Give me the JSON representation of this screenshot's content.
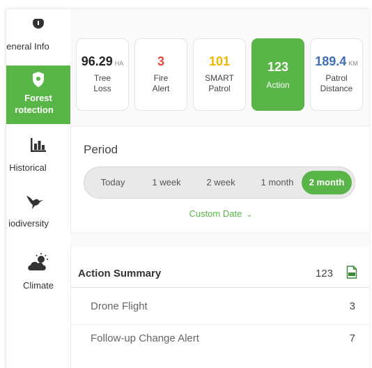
{
  "sidebar": {
    "items": [
      {
        "label": "eneral Info",
        "icon": "info-icon"
      },
      {
        "label": "Forest Protection",
        "label_line1": "Forest",
        "label_line2": "rotection",
        "icon": "shield-icon",
        "active": true
      },
      {
        "label": "Historical",
        "display": "Historical",
        "icon": "bar-chart-icon"
      },
      {
        "label": "iodiversity",
        "icon": "bird-icon"
      },
      {
        "label": "Climate",
        "icon": "cloud-sun-icon"
      }
    ]
  },
  "stats": [
    {
      "value": "96.29",
      "unit": "HA",
      "label_line1": "Tree",
      "label_line2": "Loss",
      "color": "#222222"
    },
    {
      "value": "3",
      "unit": "",
      "label_line1": "Fire",
      "label_line2": "Alert",
      "color": "#e8453c"
    },
    {
      "value": "101",
      "unit": "",
      "label_line1": "SMART",
      "label_line2": "Patrol",
      "color": "#f4b400"
    },
    {
      "value": "123",
      "unit": "",
      "label_line1": "Action",
      "label_line2": "",
      "color": "#ffffff",
      "active": true
    },
    {
      "value": "189.4",
      "unit": "KM",
      "label_line1": "Patrol",
      "label_line2": "Distance",
      "color": "#3d6fb6"
    }
  ],
  "period": {
    "title": "Period",
    "options": [
      "Today",
      "1 week",
      "2 week",
      "1 month",
      "2 month"
    ],
    "selected": "2 month",
    "custom_date": "Custom Date"
  },
  "summary": {
    "title": "Action Summary",
    "count": "123",
    "rows": [
      {
        "name": "Drone Flight",
        "value": "3"
      },
      {
        "name": "Follow-up Change Alert",
        "value": "7"
      }
    ]
  },
  "colors": {
    "accent": "#59b548",
    "fire": "#e8453c",
    "smart": "#f4b400",
    "patrol": "#3d6fb6"
  }
}
